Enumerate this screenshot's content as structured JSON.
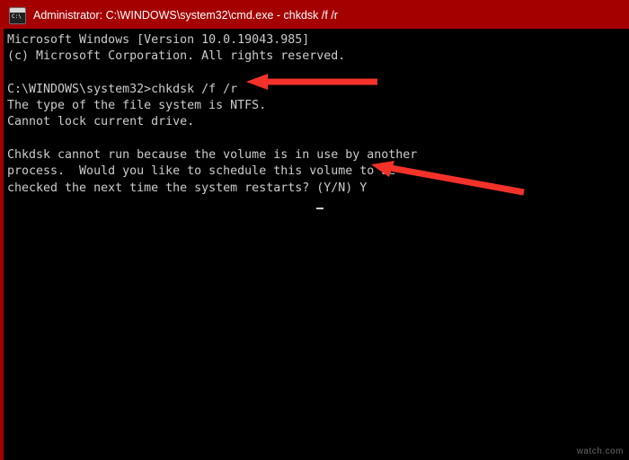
{
  "window": {
    "title": "Administrator: C:\\WINDOWS\\system32\\cmd.exe - chkdsk  /f /r",
    "icon": "cmd-icon",
    "frame_color": "#a50000",
    "console_bg": "#000000",
    "console_fg": "#cccccc"
  },
  "console": {
    "text": "Microsoft Windows [Version 10.0.19043.985]\n(c) Microsoft Corporation. All rights reserved.\n\nC:\\WINDOWS\\system32>chkdsk /f /r\nThe type of the file system is NTFS.\nCannot lock current drive.\n\nChkdsk cannot run because the volume is in use by another\nprocess.  Would you like to schedule this volume to be\nchecked the next time the system restarts? (Y/N) Y",
    "lines": [
      "Microsoft Windows [Version 10.0.19043.985]",
      "(c) Microsoft Corporation. All rights reserved.",
      "",
      "C:\\WINDOWS\\system32>chkdsk /f /r",
      "The type of the file system is NTFS.",
      "Cannot lock current drive.",
      "",
      "Chkdsk cannot run because the volume is in use by another",
      "process.  Would you like to schedule this volume to be",
      "checked the next time the system restarts? (Y/N) Y"
    ],
    "cursor": "block-cursor"
  },
  "annotations": {
    "color": "#f5322a",
    "arrow1": {
      "name": "arrow-pointing-to-chkdsk-command",
      "points_to": "chkdsk /f /r"
    },
    "arrow2": {
      "name": "arrow-pointing-to-yes-response",
      "points_to": "(Y/N) Y"
    }
  },
  "watermark": {
    "text": "watch.com"
  }
}
